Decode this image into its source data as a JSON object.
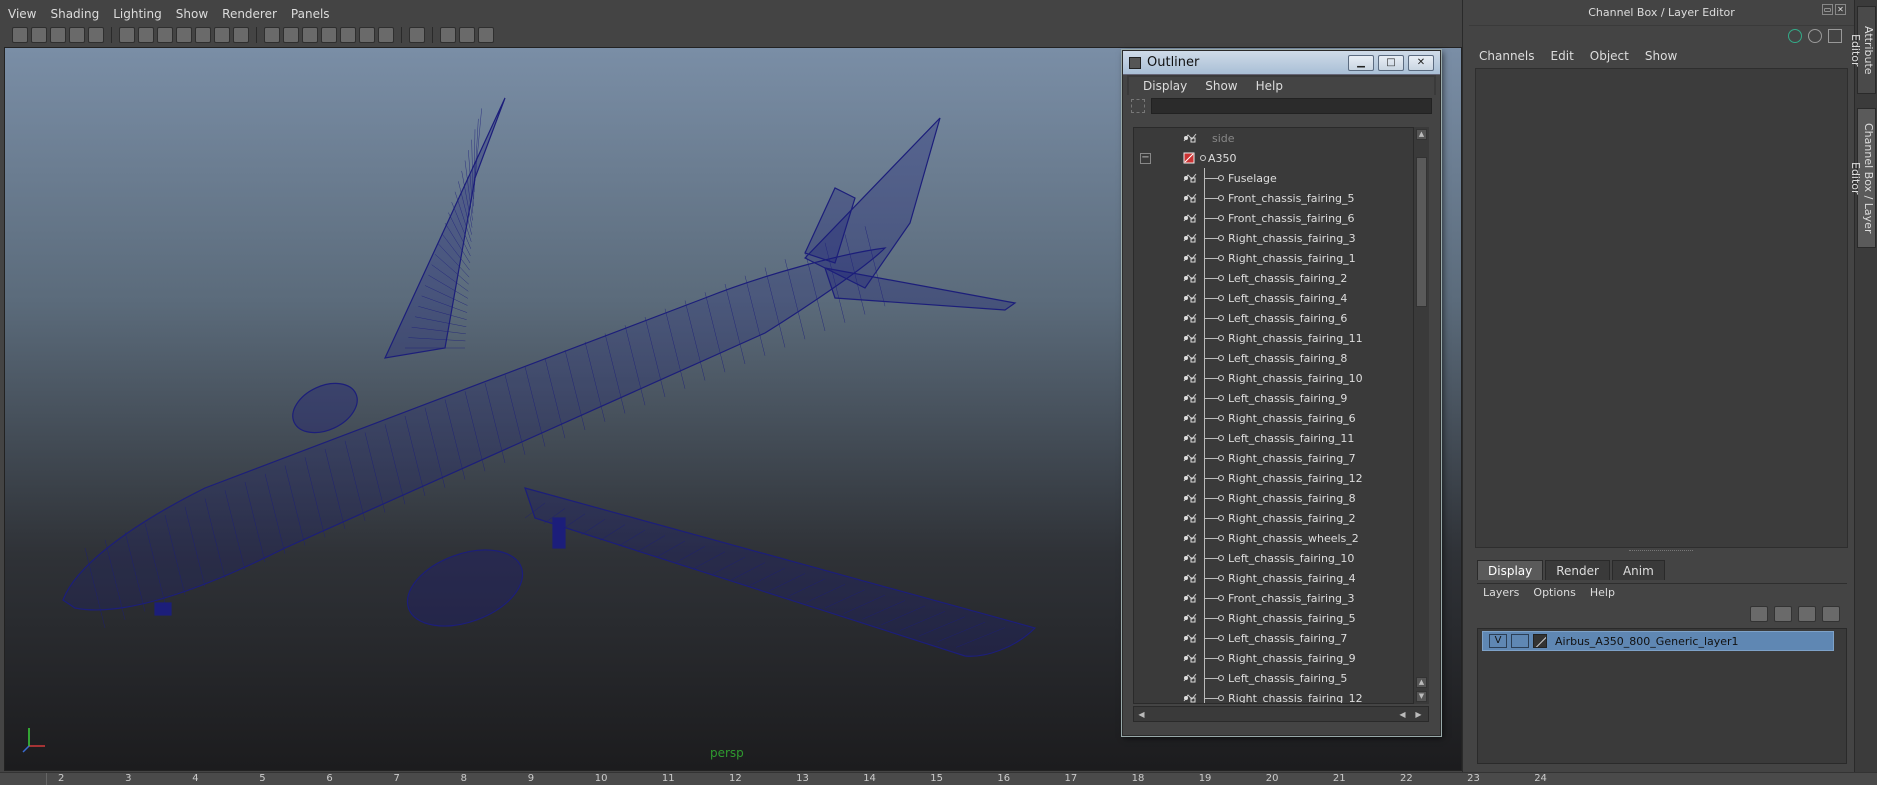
{
  "viewport_panel": {
    "menu": [
      "View",
      "Shading",
      "Lighting",
      "Show",
      "Renderer",
      "Panels"
    ],
    "camera_label": "persp",
    "model_wire_color": "#1c1e7a"
  },
  "timeline": {
    "ticks": [
      "2",
      "3",
      "4",
      "5",
      "6",
      "7",
      "8",
      "9",
      "10",
      "11",
      "12",
      "13",
      "14",
      "15",
      "16",
      "17",
      "18",
      "19",
      "20",
      "21",
      "22",
      "23",
      "24"
    ]
  },
  "outliner": {
    "title": "Outliner",
    "menu": [
      "Display",
      "Show",
      "Help"
    ],
    "search_value": "",
    "tree": [
      {
        "label": "side",
        "kind": "camera"
      },
      {
        "label": "A350",
        "kind": "group",
        "collapse": "−"
      },
      {
        "label": "Fuselage",
        "kind": "child"
      },
      {
        "label": "Front_chassis_fairing_5",
        "kind": "child"
      },
      {
        "label": "Front_chassis_fairing_6",
        "kind": "child"
      },
      {
        "label": "Right_chassis_fairing_3",
        "kind": "child"
      },
      {
        "label": "Right_chassis_fairing_1",
        "kind": "child"
      },
      {
        "label": "Left_chassis_fairing_2",
        "kind": "child"
      },
      {
        "label": "Left_chassis_fairing_4",
        "kind": "child"
      },
      {
        "label": "Left_chassis_fairing_6",
        "kind": "child"
      },
      {
        "label": "Right_chassis_fairing_11",
        "kind": "child"
      },
      {
        "label": "Left_chassis_fairing_8",
        "kind": "child"
      },
      {
        "label": "Right_chassis_fairing_10",
        "kind": "child"
      },
      {
        "label": "Left_chassis_fairing_9",
        "kind": "child"
      },
      {
        "label": "Right_chassis_fairing_6",
        "kind": "child"
      },
      {
        "label": "Left_chassis_fairing_11",
        "kind": "child"
      },
      {
        "label": "Right_chassis_fairing_7",
        "kind": "child"
      },
      {
        "label": "Right_chassis_fairing_12",
        "kind": "child"
      },
      {
        "label": "Right_chassis_fairing_8",
        "kind": "child"
      },
      {
        "label": "Right_chassis_fairing_2",
        "kind": "child"
      },
      {
        "label": "Right_chassis_wheels_2",
        "kind": "child"
      },
      {
        "label": "Left_chassis_fairing_10",
        "kind": "child"
      },
      {
        "label": "Right_chassis_fairing_4",
        "kind": "child"
      },
      {
        "label": "Front_chassis_fairing_3",
        "kind": "child"
      },
      {
        "label": "Right_chassis_fairing_5",
        "kind": "child"
      },
      {
        "label": "Left_chassis_fairing_7",
        "kind": "child"
      },
      {
        "label": "Right_chassis_fairing_9",
        "kind": "child"
      },
      {
        "label": "Left_chassis_fairing_5",
        "kind": "child"
      },
      {
        "label": "Right_chassis_fairing_12",
        "kind": "child"
      }
    ]
  },
  "channel_box": {
    "title": "Channel Box / Layer Editor",
    "menu": [
      "Channels",
      "Edit",
      "Object",
      "Show"
    ]
  },
  "layer_editor": {
    "tabs": [
      "Display",
      "Render",
      "Anim"
    ],
    "active_tab": "Display",
    "menu": [
      "Layers",
      "Options",
      "Help"
    ],
    "layers": [
      {
        "visible": "V",
        "name": "Airbus_A350_800_Generic_layer1"
      }
    ],
    "selection_color": "#5f87b3"
  },
  "side_tabs": [
    "Attribute Editor",
    "Channel Box / Layer Editor"
  ]
}
